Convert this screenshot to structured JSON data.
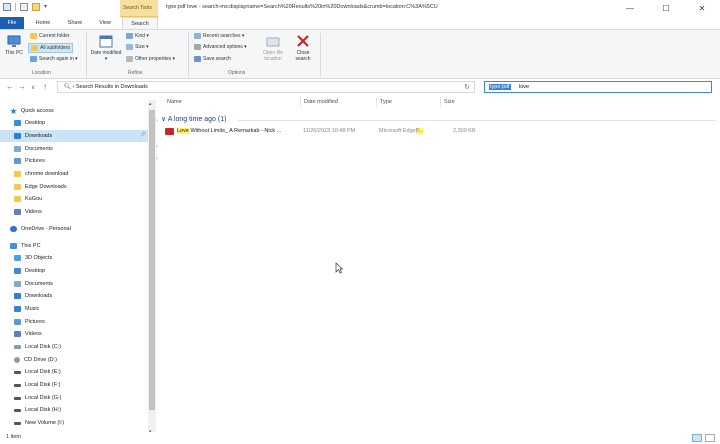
{
  "window": {
    "title": "type:pdf love - search-ms:displayname=Search%20Results%20in%20Downloads&crumb=location:C%3A%5CU",
    "context_tab_group": "Search Tools",
    "controls": {
      "minimize": "—",
      "maximize": "☐",
      "close": "✕"
    }
  },
  "ribbon_tabs": [
    "File",
    "Home",
    "Share",
    "View",
    "Search"
  ],
  "ribbon": {
    "location": {
      "this_pc": "This PC",
      "current_folder": "Current folder",
      "all_subfolders": "All subfolders",
      "search_again": "Search again in ▾",
      "label": "Location"
    },
    "refine": {
      "date_modified": "Date modified ▾",
      "kind": "Kind ▾",
      "size": "Size ▾",
      "other_properties": "Other properties ▾",
      "label": "Refine"
    },
    "options": {
      "recent_searches": "Recent searches ▾",
      "advanced_options": "Advanced options ▾",
      "save_search": "Save search",
      "open_file_location": "Open file location",
      "close_search": "Close search",
      "label": "Options"
    }
  },
  "address": {
    "breadcrumb": "Search Results in Downloads",
    "search_selected": "type:pdf",
    "search_rest": "love"
  },
  "nav": {
    "quick_access": "Quick access",
    "quick_items": [
      "Desktop",
      "Downloads",
      "Documents",
      "Pictures",
      "chrome download",
      "Edge Downloads",
      "KuGou",
      "Videos"
    ],
    "onedrive": "OneDrive - Personal",
    "this_pc": "This PC",
    "pc_items": [
      "3D Objects",
      "Desktop",
      "Documents",
      "Downloads",
      "Music",
      "Pictures",
      "Videos",
      "Local Disk (C:)",
      "CD Drive (D:)",
      "Local Disk (E:)",
      "Local Disk (F:)",
      "Local Disk (G:)",
      "Local Disk (H:)",
      "New Volume (I:)"
    ]
  },
  "columns": [
    "Name",
    "Date modified",
    "Type",
    "Size"
  ],
  "group": "A long time ago (1)",
  "file": {
    "name_highlight": "Love",
    "name_rest": " Without Limits_ A Remarkab - Nick ...",
    "date": "11/26/2023 10:48 PM",
    "type_prefix": "Microsoft Edge",
    "type_highlight": "P...",
    "size": "2,300 KB"
  },
  "status": {
    "count": "1 item"
  },
  "colors": {
    "file_tab": "#1a5fb4",
    "selection": "#cce4f7",
    "accent": "#3b7fd6",
    "highlight": "#fff263",
    "pdf_icon": "#c62828"
  }
}
